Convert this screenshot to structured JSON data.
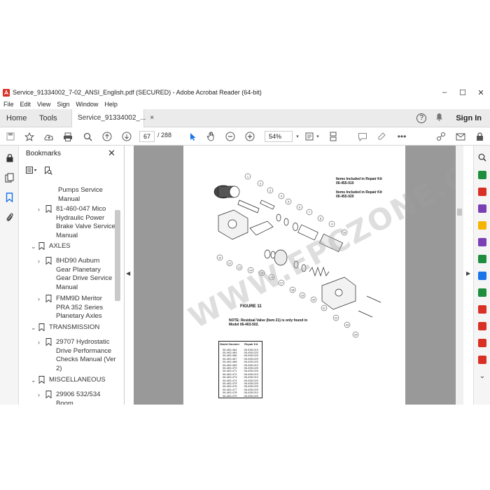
{
  "window": {
    "title": "Service_91334002_7-02_ANSI_English.pdf (SECURED) - Adobe Acrobat Reader (64-bit)",
    "controls": [
      "–",
      "☐",
      "✕"
    ]
  },
  "menu": [
    "File",
    "Edit",
    "View",
    "Sign",
    "Window",
    "Help"
  ],
  "tabs": {
    "home": "Home",
    "tools": "Tools",
    "document": "Service_91334002_...",
    "close": "×",
    "help": "?",
    "sign_in": "Sign In"
  },
  "toolbar": {
    "page_current": "67",
    "page_total": "/ 288",
    "zoom": "54%",
    "icons": [
      "save-icon",
      "bookmark-star-icon",
      "cloud-upload-icon",
      "print-icon",
      "search-icon",
      "page-up-icon",
      "page-down-icon",
      "select-arrow-icon",
      "hand-icon",
      "zoom-out-icon",
      "zoom-in-icon",
      "fit-page-icon",
      "scrolling-icon",
      "comment-icon",
      "highlight-icon",
      "more-icon",
      "share-link-icon",
      "email-icon",
      "lock-icon"
    ]
  },
  "bookmarks": {
    "header": "Bookmarks",
    "close": "✕",
    "items": [
      {
        "label": "Pumps Service Manual",
        "chevron": "",
        "level": 2,
        "flag": false
      },
      {
        "label": "81-460-047 Mico Hydraulic Power Brake Valve Service Manual",
        "chevron": "›",
        "level": 2,
        "flag": true
      },
      {
        "label": "AXLES",
        "chevron": "⌄",
        "level": 1,
        "flag": true
      },
      {
        "label": "8HD90 Auburn Gear Planetary Gear Drive Service Manual",
        "chevron": "›",
        "level": 2,
        "flag": true
      },
      {
        "label": "FMM9D Meritor PRA 352 Series Planetary Axles",
        "chevron": "›",
        "level": 2,
        "flag": true
      },
      {
        "label": "TRANSMISSION",
        "chevron": "⌄",
        "level": 1,
        "flag": true
      },
      {
        "label": "29707 Hydrostatic Drive Performance Checks Manual (Ver 2)",
        "chevron": "›",
        "level": 2,
        "flag": true
      },
      {
        "label": "MISCELLANEOUS",
        "chevron": "⌄",
        "level": 1,
        "flag": true
      },
      {
        "label": "29906 532/534 Boom",
        "chevron": "›",
        "level": 2,
        "flag": true
      }
    ]
  },
  "pdf": {
    "legend_1": "Items Included in Repair Kit 06-455-010",
    "legend_2": "Items Included in Repair Kit 06-455-020",
    "figure_label": "FIGURE 11",
    "note": "NOTE: Residual Valve (Item 21) is only found in Model 06-463-502.",
    "table_headers": [
      "Model Number",
      "Repair Kit"
    ],
    "table_rows": [
      [
        "06-463-464",
        "06-455-010"
      ],
      [
        "06-463-465",
        "06-455-020"
      ],
      [
        "06-463-466",
        "06-455-020"
      ],
      [
        "06-463-467",
        "06-455-020"
      ],
      [
        "06-463-468",
        "06-455-020"
      ],
      [
        "06-463-469",
        "06-455-010"
      ],
      [
        "06-463-470",
        "06-455-020"
      ],
      [
        "06-463-471",
        "06-455-020"
      ],
      [
        "06-463-472",
        "06-455-010"
      ],
      [
        "06-463-473",
        "06-455-010"
      ],
      [
        "06-463-474",
        "06-455-020"
      ],
      [
        "06-463-475",
        "06-455-020"
      ],
      [
        "06-463-476",
        "06-455-020"
      ],
      [
        "06-463-477",
        "06-455-020"
      ],
      [
        "06-463-478",
        "06-455-010"
      ],
      [
        "06-463-479",
        "06-455-020"
      ]
    ],
    "callouts": [
      "1",
      "2",
      "3",
      "4",
      "5",
      "6",
      "7",
      "8",
      "9",
      "10",
      "11",
      "12",
      "13",
      "14",
      "15",
      "16",
      "17",
      "18",
      "19",
      "20",
      "21",
      "22",
      "23",
      "24"
    ],
    "watermark": "WWW.EPCZONE.COM"
  },
  "colors": {
    "tab_bar": "#ebebeb",
    "viewer_bg": "#999999",
    "icon_blue": "#1a73e8",
    "icon_red": "#d93025",
    "icon_green": "#1e8e3e",
    "icon_purple": "#7b3fb5",
    "icon_yellow": "#f4b400"
  }
}
